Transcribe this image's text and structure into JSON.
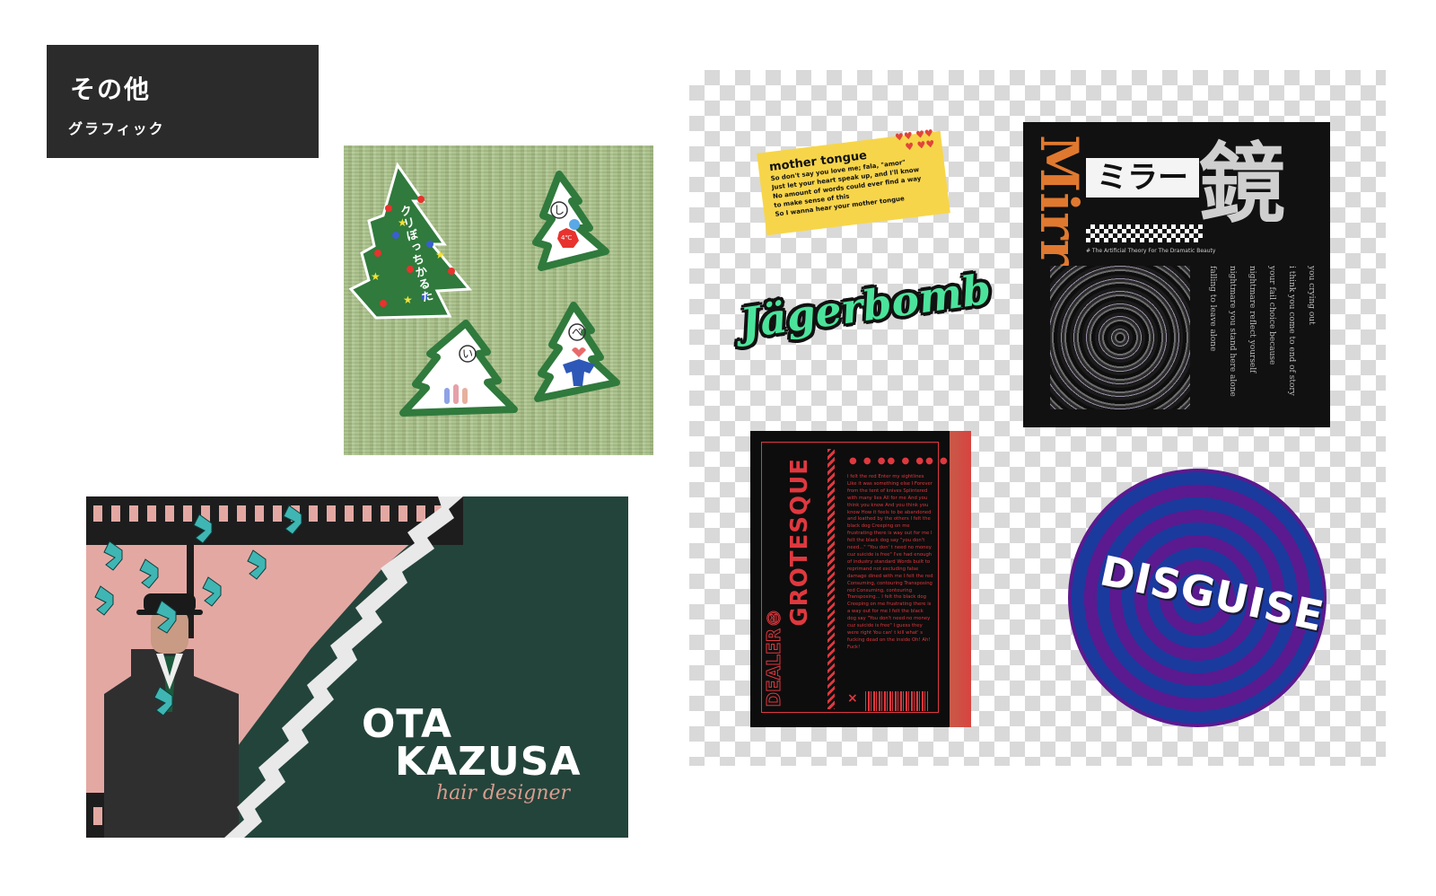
{
  "header": {
    "title": "その他",
    "subtitle": "グラフィック"
  },
  "karuta": {
    "title": "クリぼっちかるた",
    "card_a": "し",
    "card_a_badge": "4℃",
    "card_b": "い",
    "card_c": "べ"
  },
  "mother_tongue": {
    "title": "mother tongue",
    "lines": [
      "So don't say you love me; fala, \"amor\"",
      "Just let your heart speak up, and I'll know",
      "No amount of words could ever find a way",
      "to make sense of this",
      "So I wanna hear your mother tongue"
    ]
  },
  "jager": {
    "text": "Jägerbomb"
  },
  "mirror": {
    "latin": "Mirr",
    "katakana": "ミラー",
    "kanji": "鏡",
    "caption": "# The Artificial Theory For The Dramatic Beauty",
    "poem": [
      "you crying out",
      "i think you come to end of story",
      "your fail choice because",
      "nightmare reflect yourself",
      "nightmare you stand here alone",
      "falling to leave alone"
    ]
  },
  "grotesque": {
    "title": "GROTESQUE",
    "subtitle": "DEALER®",
    "mark": "×",
    "body": "I felt the red Enter my sightlines Like it was something else I Forever from the tent of knives Splintered with many lies All for me And you think you know And you think you know How it feels to be abandoned and loathed by the others I felt the black dog Creeping on me frustrating there is way out for me I felt the black dog say \"you don't need...\" \"You don' t need no money cuz suicide is free\" I've had enough of industry standard Words built to reprimand not excluding false damage dined with me I felt the red Consuming, contouring Transposing red Consuming, contouring Transposing... I felt the black dog Creeping on me frustrating there is a way out for me I felt the black dog say \"You don't need no money cuz suicide is free\" I guess they were right You can' t kill what' s fucking dead on the inside Oh! Ah! Fuck!"
  },
  "disguise": {
    "text": "DISGUISE"
  },
  "card": {
    "name_line1": "OTA",
    "name_line2": "KAZUSA",
    "tagline": "hair designer"
  },
  "colors": {
    "header_bg": "#2b2b2b",
    "tree_green": "#2f7a3c",
    "sticker_yellow": "#f7d54a",
    "neon_green": "#4be39b",
    "card_green": "#23443b",
    "card_pink": "#e4a8a3",
    "butterfly": "#3fb6b3",
    "grotesque_red": "#e0383f",
    "disguise_purple": "#5b1a8f",
    "disguise_blue": "#1a3a9e"
  }
}
